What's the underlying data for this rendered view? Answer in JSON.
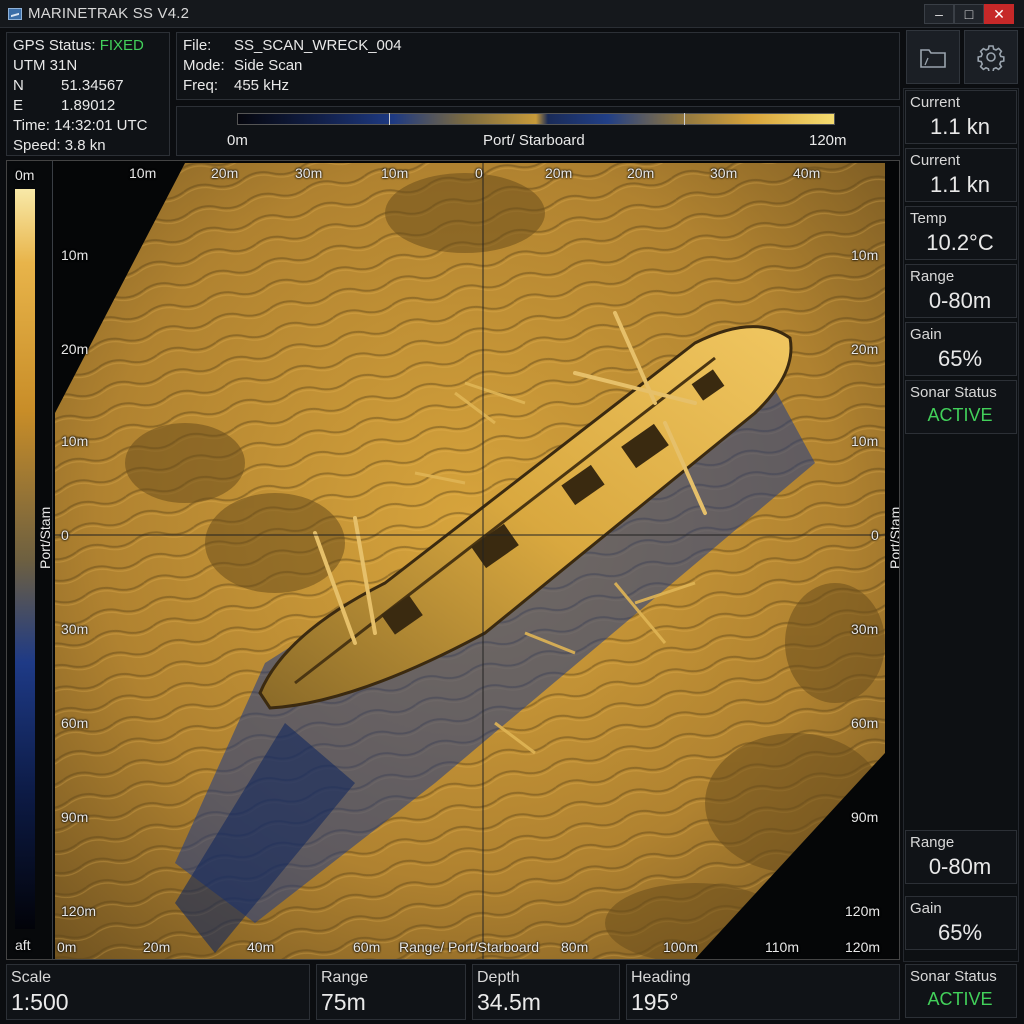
{
  "window": {
    "title": "MARINETRAK SS V4.2",
    "min": "–",
    "max": "□",
    "close": "✕"
  },
  "gps": {
    "status_label": "GPS Status:",
    "status_value": "FIXED",
    "zone": "UTM 31N",
    "n_label": "N",
    "n_value": "51.34567",
    "e_label": "E",
    "e_value": "1.89012",
    "time": "Time: 14:32:01 UTC",
    "speed": "Speed: 3.8 kn"
  },
  "file": {
    "file_label": "File:",
    "file_value": "SS_SCAN_WRECK_004",
    "mode_label": "Mode:",
    "mode_value": "Side Scan",
    "freq_label": "Freq:",
    "freq_value": "455 kHz"
  },
  "colorbar": {
    "min": "0m",
    "center": "Port/ Starboard",
    "max": "120m"
  },
  "toolbar": {
    "folder_icon": "folder-icon",
    "gear_icon": "gear-icon"
  },
  "right_cards_top": [
    {
      "title": "Current",
      "value": "1.1 kn"
    },
    {
      "title": "Current",
      "value": "1.1 kn"
    },
    {
      "title": "Temp",
      "value": "10.2°C"
    },
    {
      "title": "Range",
      "value": "0-80m"
    },
    {
      "title": "Gain",
      "value": "65%"
    },
    {
      "title": "Sonar Status",
      "value": "ACTIVE"
    }
  ],
  "right_cards_bottom": [
    {
      "title": "Range",
      "value": "0-80m"
    },
    {
      "title": "Gain",
      "value": "65%"
    },
    {
      "title": "Sonar Status",
      "value": "ACTIVE"
    }
  ],
  "view": {
    "top_labels": [
      "10m",
      "20m",
      "30m",
      "10m",
      "0",
      "20m",
      "20m",
      "30m",
      "40m"
    ],
    "left_labels": [
      "10m",
      "20m",
      "10m",
      "0",
      "30m",
      "60m",
      "90m",
      "120m"
    ],
    "right_labels": [
      "10m",
      "20m",
      "10m",
      "0",
      "30m",
      "60m",
      "90m",
      "120m"
    ],
    "bottom_labels": [
      "0m",
      "20m",
      "40m",
      "60m",
      "Range/ Port/Starboard",
      "80m",
      "100m",
      "110m",
      "120m"
    ],
    "scale_top": "0m",
    "scale_bottom": "aft",
    "side_label_left": "Port/Stam",
    "side_label_right": "Port/Stam"
  },
  "stats": [
    {
      "title": "Scale",
      "value": "1:500"
    },
    {
      "title": "Range",
      "value": "75m"
    },
    {
      "title": "Depth",
      "value": "34.5m"
    },
    {
      "title": "Heading",
      "value": "195°"
    }
  ],
  "colors": {
    "accent_green": "#42d05a",
    "close_red": "#c62828",
    "sand": "#c8952e",
    "shadow_blue": "#1e3a86"
  }
}
